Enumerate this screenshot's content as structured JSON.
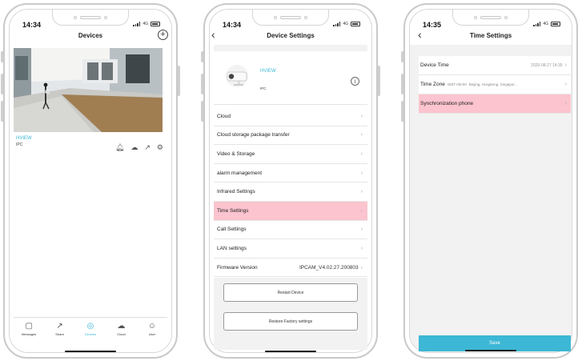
{
  "phones": {
    "devices": {
      "status": {
        "time": "14:34",
        "network": "4G"
      },
      "title": "Devices",
      "device": {
        "brand": "HVIEW",
        "model": "IPC"
      },
      "tabs": [
        "Messages",
        "Share",
        "Devices",
        "Cloud",
        "User"
      ],
      "active_tab": "Devices"
    },
    "device_settings": {
      "status": {
        "time": "14:34",
        "network": "4G"
      },
      "title": "Device Settings",
      "device": {
        "brand": "HVIEW",
        "model": "IPC"
      },
      "rows": [
        {
          "label": "Cloud"
        },
        {
          "label": "Cloud storage package transfer"
        },
        {
          "label": "Video & Storage"
        },
        {
          "label": "alarm management"
        },
        {
          "label": "Infrared Settings"
        },
        {
          "label": "Time Settings",
          "highlight": true
        },
        {
          "label": "Call Settings"
        },
        {
          "label": "LAN settings"
        },
        {
          "label": "Firmware Version",
          "value": "IPCAM_V4.02.27.200803"
        }
      ],
      "restart_label": "Restart Device",
      "restore_label": "Restore Factory settings"
    },
    "time_settings": {
      "status": {
        "time": "14:35",
        "network": "4G"
      },
      "title": "Time Settings",
      "device_time_label": "Device Time",
      "device_time_value": "2020-08-27 14:35",
      "time_zone_label": "Time Zone",
      "time_zone_sub": "GMT+08:00",
      "time_zone_value": "Beijing, Hongkong, Singapor...",
      "sync_label": "Synchronization phone",
      "save_label": "Save"
    }
  },
  "colors": {
    "accent": "#3cb7d5",
    "highlight": "#fbc4ce"
  }
}
